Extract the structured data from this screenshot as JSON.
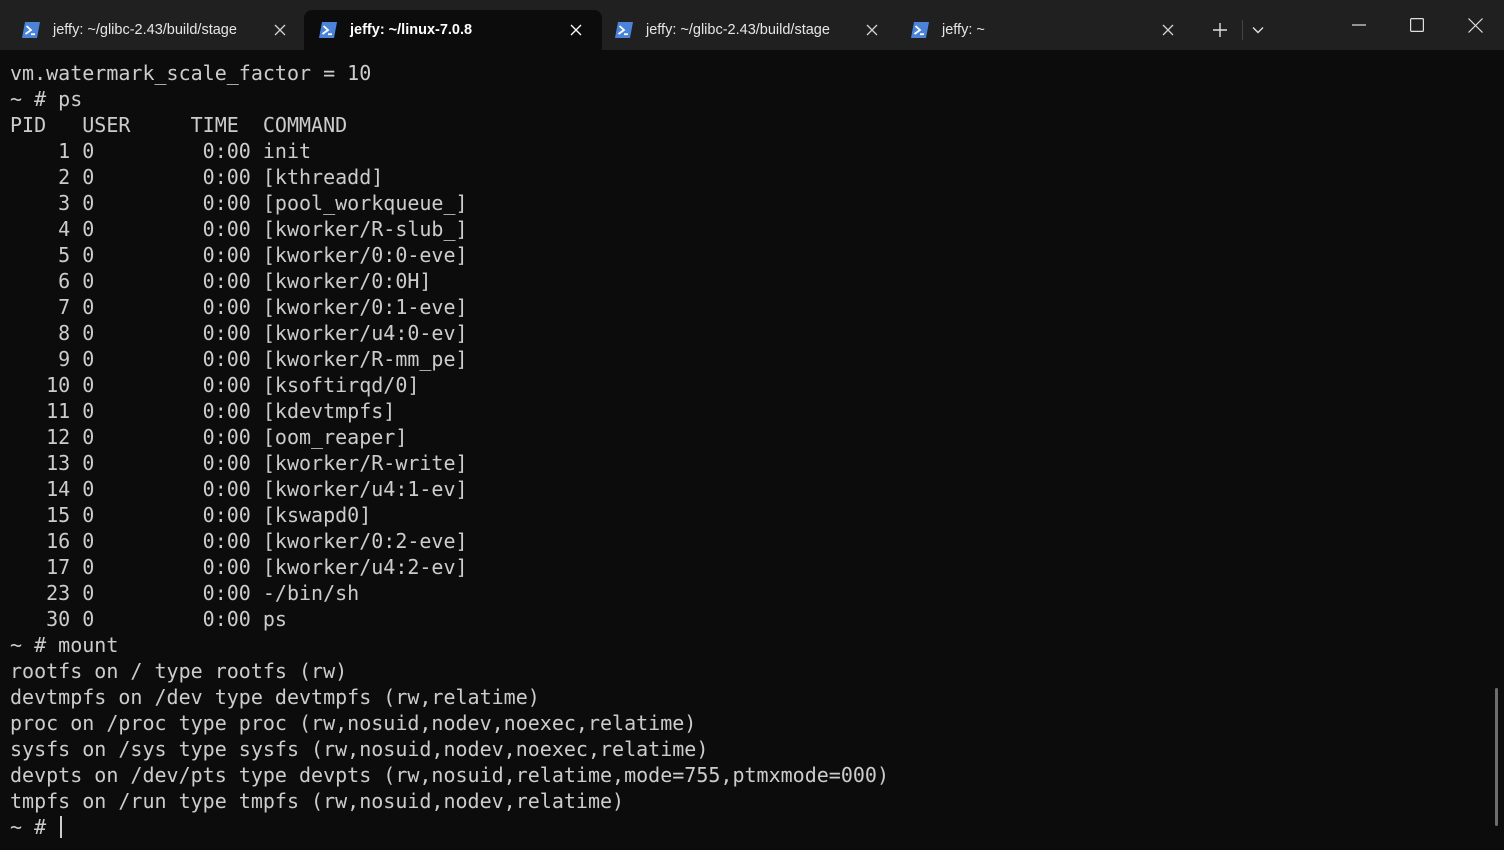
{
  "tabs": [
    {
      "title": "jeffy: ~/glibc-2.43/build/stage",
      "active": false
    },
    {
      "title": "jeffy: ~/linux-7.0.8",
      "active": true
    },
    {
      "title": "jeffy: ~/glibc-2.43/build/stage",
      "active": false
    },
    {
      "title": "jeffy: ~",
      "active": false
    }
  ],
  "tab_icon": "powershell-icon",
  "window_buttons": [
    "new-tab-plus-icon",
    "tab-dropdown-chevron-icon",
    "minimize-icon",
    "maximize-icon",
    "close-icon"
  ],
  "colors": {
    "titlebar": "#202020",
    "terminal_bg": "#0c0c0c",
    "terminal_fg": "#cccccc",
    "icon_blue": "#4a83d9"
  },
  "terminal": {
    "lines": [
      "vm.watermark_scale_factor = 10",
      "~ # ps",
      "PID   USER     TIME  COMMAND",
      "    1 0         0:00 init",
      "    2 0         0:00 [kthreadd]",
      "    3 0         0:00 [pool_workqueue_]",
      "    4 0         0:00 [kworker/R-slub_]",
      "    5 0         0:00 [kworker/0:0-eve]",
      "    6 0         0:00 [kworker/0:0H]",
      "    7 0         0:00 [kworker/0:1-eve]",
      "    8 0         0:00 [kworker/u4:0-ev]",
      "    9 0         0:00 [kworker/R-mm_pe]",
      "   10 0         0:00 [ksoftirqd/0]",
      "   11 0         0:00 [kdevtmpfs]",
      "   12 0         0:00 [oom_reaper]",
      "   13 0         0:00 [kworker/R-write]",
      "   14 0         0:00 [kworker/u4:1-ev]",
      "   15 0         0:00 [kswapd0]",
      "   16 0         0:00 [kworker/0:2-eve]",
      "   17 0         0:00 [kworker/u4:2-ev]",
      "   23 0         0:00 -/bin/sh",
      "   30 0         0:00 ps",
      "~ # mount",
      "rootfs on / type rootfs (rw)",
      "devtmpfs on /dev type devtmpfs (rw,relatime)",
      "proc on /proc type proc (rw,nosuid,nodev,noexec,relatime)",
      "sysfs on /sys type sysfs (rw,nosuid,nodev,noexec,relatime)",
      "devpts on /dev/pts type devpts (rw,nosuid,relatime,mode=755,ptmxmode=000)",
      "tmpfs on /run type tmpfs (rw,nosuid,nodev,relatime)"
    ],
    "prompt": "~ # "
  }
}
